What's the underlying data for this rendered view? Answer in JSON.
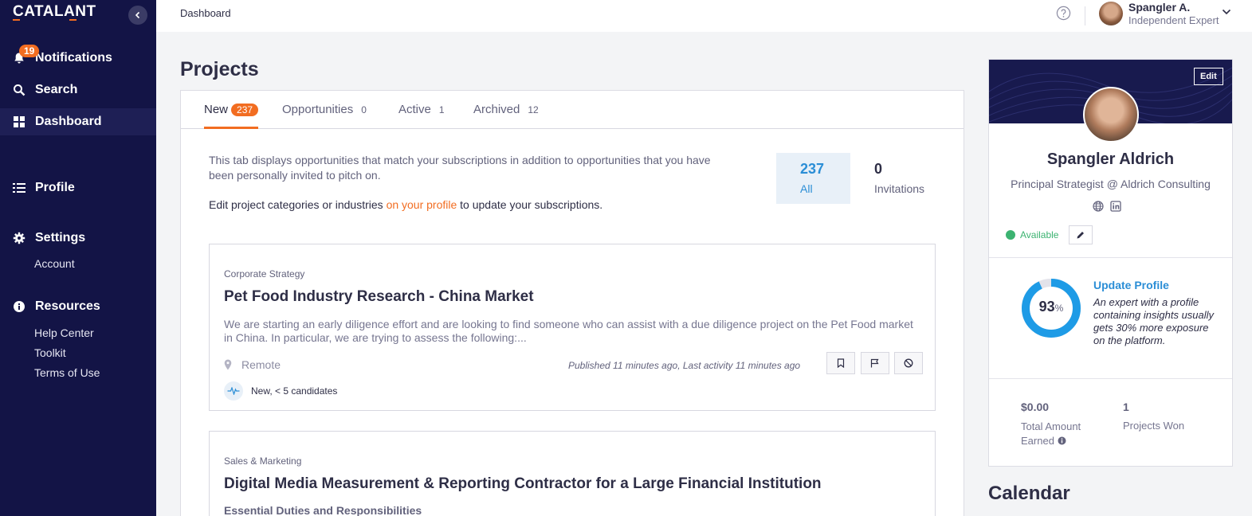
{
  "app": {
    "brand": "CATALANT"
  },
  "sidebar": {
    "notifications_count": "19",
    "items": [
      {
        "label": "Notifications",
        "icon": "bell-icon"
      },
      {
        "label": "Search",
        "icon": "search-icon"
      },
      {
        "label": "Dashboard",
        "icon": "grid-icon"
      },
      {
        "label": "Profile",
        "icon": "list-icon"
      },
      {
        "label": "Settings",
        "icon": "gear-icon"
      },
      {
        "label": "Resources",
        "icon": "info-icon"
      }
    ],
    "settings_sub": [
      "Account"
    ],
    "resources_sub": [
      "Help Center",
      "Toolkit",
      "Terms of Use"
    ]
  },
  "topbar": {
    "breadcrumb": "Dashboard",
    "user_name": "Spangler A.",
    "user_role": "Independent Expert"
  },
  "main": {
    "title": "Projects",
    "tabs": [
      {
        "label": "New",
        "count": "237"
      },
      {
        "label": "Opportunities",
        "count": "0"
      },
      {
        "label": "Active",
        "count": "1"
      },
      {
        "label": "Archived",
        "count": "12"
      }
    ],
    "info_text": "This tab displays opportunities that match your subscriptions in addition to opportunities that you have been personally invited to pitch on.",
    "info_prefix": "Edit project categories or industries ",
    "info_link": "on your profile",
    "info_suffix": " to update your subscriptions.",
    "stats": {
      "all_value": "237",
      "all_label": "All",
      "invitations_value": "0",
      "invitations_label": "Invitations"
    },
    "projects": [
      {
        "category": "Corporate Strategy",
        "title": "Pet Food Industry Research - China Market",
        "description": "We are starting an early diligence effort and are looking to find someone who can assist with a due diligence project on the Pet Food market in China.  In particular, we are trying to assess the following:...",
        "location": "Remote",
        "published": "Published 11 minutes ago, Last activity 11 minutes ago",
        "candidates": "New, < 5 candidates"
      },
      {
        "category": "Sales & Marketing",
        "title": "Digital Media Measurement & Reporting Contractor for a Large Financial Institution",
        "subheading": "Essential Duties and Responsibilities"
      }
    ]
  },
  "profile": {
    "edit_label": "Edit",
    "name": "Spangler Aldrich",
    "role": "Principal Strategist @ Aldrich Consulting",
    "availability": "Available",
    "completion_percent": 93,
    "completion_value": "93",
    "completion_unit": "%",
    "update_title": "Update Profile",
    "update_desc": "An expert with a profile containing insights usually gets 30% more exposure on the platform.",
    "earned_value": "$0.00",
    "earned_label": "Total Amount Earned",
    "won_value": "1",
    "won_label": "Projects Won"
  },
  "calendar": {
    "title": "Calendar"
  },
  "colors": {
    "sidebar": "#131446",
    "accent": "#f26d21",
    "link": "#2b8ed6",
    "available": "#3cb371"
  }
}
